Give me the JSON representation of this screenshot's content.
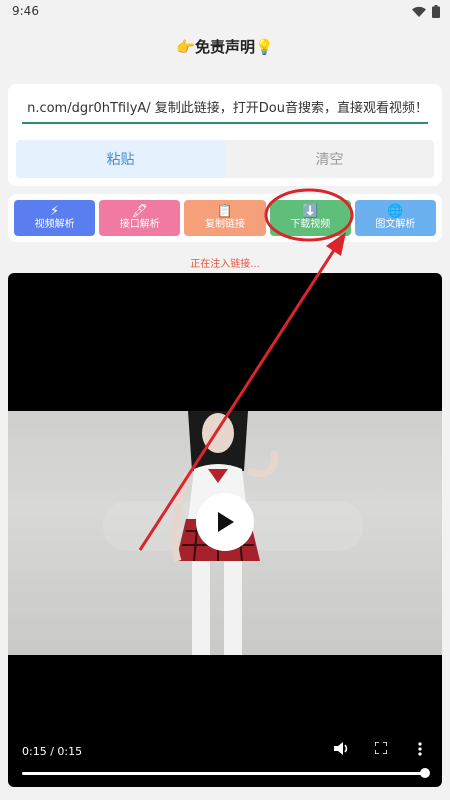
{
  "status_bar": {
    "time": "9:46",
    "wifi_icon": "wifi-icon",
    "battery_icon": "battery-icon"
  },
  "header": {
    "title": "👉免责声明💡"
  },
  "link_card": {
    "input_value": "n.com/dgr0hTfilyA/ 复制此链接，打开Dou音搜索，直接观看视频！",
    "paste_label": "粘贴",
    "clear_label": "清空"
  },
  "functions": [
    {
      "icon": "⚡",
      "label": "视频解析",
      "color": "#5a7df0"
    },
    {
      "icon": "🖋",
      "label": "接口解析",
      "color": "#f07aa2"
    },
    {
      "icon": "📋",
      "label": "复制链接",
      "color": "#f6a07b"
    },
    {
      "icon": "⬇️",
      "label": "下载视频",
      "color": "#5fbf7a"
    },
    {
      "icon": "🌐",
      "label": "图文解析",
      "color": "#6bb1f0"
    }
  ],
  "status_text": "正在注入链接...",
  "video": {
    "time_display": "0:15 / 0:15",
    "progress": 1.0,
    "play_icon": "play-icon",
    "volume_icon": "volume-icon",
    "fullscreen_icon": "fullscreen-icon",
    "more_icon": "more-vertical-icon"
  },
  "annotation": {
    "color": "#d9262b"
  }
}
